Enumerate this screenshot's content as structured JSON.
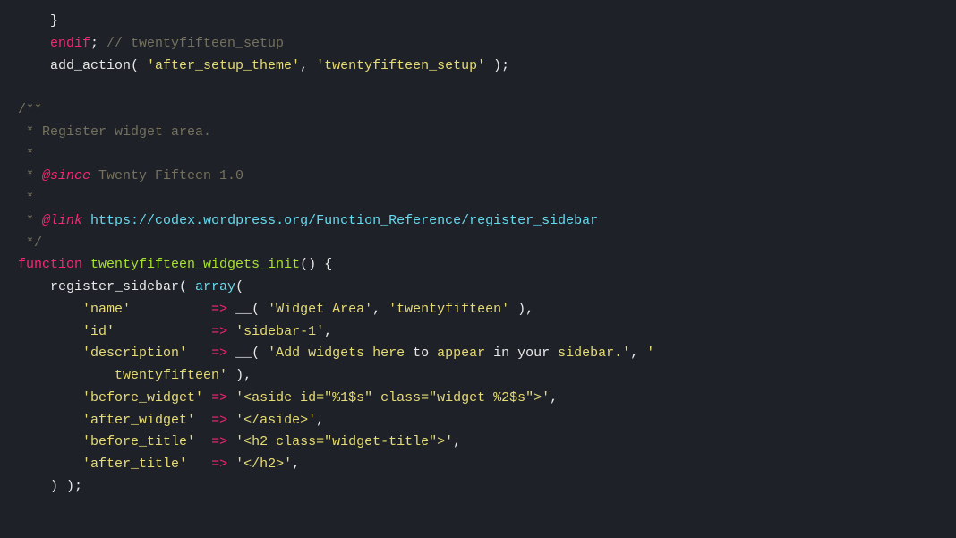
{
  "editor": {
    "background": "#1e2228",
    "lines": [
      {
        "id": "line1",
        "content": "    }"
      },
      {
        "id": "line2",
        "content": "    endif; // twentyfifteen_setup"
      },
      {
        "id": "line3",
        "content": "    add_action( 'after_setup_theme', 'twentyfifteen_setup' );"
      },
      {
        "id": "line4",
        "content": ""
      },
      {
        "id": "line5",
        "content": "/**"
      },
      {
        "id": "line6",
        "content": " * Register widget area."
      },
      {
        "id": "line7",
        "content": " *"
      },
      {
        "id": "line8",
        "content": " * @since Twenty Fifteen 1.0"
      },
      {
        "id": "line9",
        "content": " *"
      },
      {
        "id": "line10",
        "content": " * @link https://codex.wordpress.org/Function_Reference/register_sidebar"
      },
      {
        "id": "line11",
        "content": " */"
      },
      {
        "id": "line12",
        "content": "function twentyfifteen_widgets_init() {"
      },
      {
        "id": "line13",
        "content": "    register_sidebar( array("
      },
      {
        "id": "line14",
        "content": "        'name'          => __( 'Widget Area', 'twentyfifteen' ),"
      },
      {
        "id": "line15",
        "content": "        'id'            => 'sidebar-1',"
      },
      {
        "id": "line16",
        "content": "        'description'   => __( 'Add widgets here to appear in your sidebar.', '"
      },
      {
        "id": "line17",
        "content": "            twentyfifteen' ),"
      },
      {
        "id": "line18",
        "content": "        'before_widget' => '<aside id=\"%1$s\" class=\"widget %2$s\">',"
      },
      {
        "id": "line19",
        "content": "        'after_widget'  => '</aside>',"
      },
      {
        "id": "line20",
        "content": "        'before_title'  => '<h2 class=\"widget-title\">',"
      },
      {
        "id": "line21",
        "content": "        'after_title'   => '</h2>',"
      },
      {
        "id": "line22",
        "content": "    ) );"
      }
    ]
  }
}
